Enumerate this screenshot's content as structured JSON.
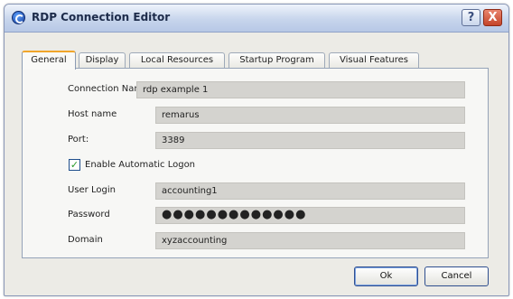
{
  "window": {
    "title": "RDP Connection Editor"
  },
  "titlebar_buttons": {
    "help": "?",
    "close": "X"
  },
  "tabs": [
    {
      "label": "General",
      "active": true
    },
    {
      "label": "Display",
      "active": false
    },
    {
      "label": "Local Resources",
      "active": false
    },
    {
      "label": "Startup Program",
      "active": false
    },
    {
      "label": "Visual Features",
      "active": false
    }
  ],
  "form": {
    "connection_name": {
      "label": "Connection Name",
      "value": "rdp example 1"
    },
    "host_name": {
      "label": "Host name",
      "value": "remarus"
    },
    "port": {
      "label": "Port:",
      "value": "3389"
    },
    "auto_logon": {
      "label": "Enable Automatic Logon",
      "checked": true
    },
    "user_login": {
      "label": "User Login",
      "value": "accounting1"
    },
    "password": {
      "label": "Password",
      "value": "●●●●●●●●●●●●●"
    },
    "domain": {
      "label": "Domain",
      "value": "xyzaccounting"
    }
  },
  "buttons": {
    "ok": "Ok",
    "cancel": "Cancel"
  },
  "icons": {
    "app": "rdp-app-icon",
    "check": "check-icon"
  },
  "colors": {
    "active_tab_accent": "#f0a52a",
    "field_bg": "#d4d3cf",
    "titlebar": "#c7d5ec",
    "close": "#c4442a"
  }
}
